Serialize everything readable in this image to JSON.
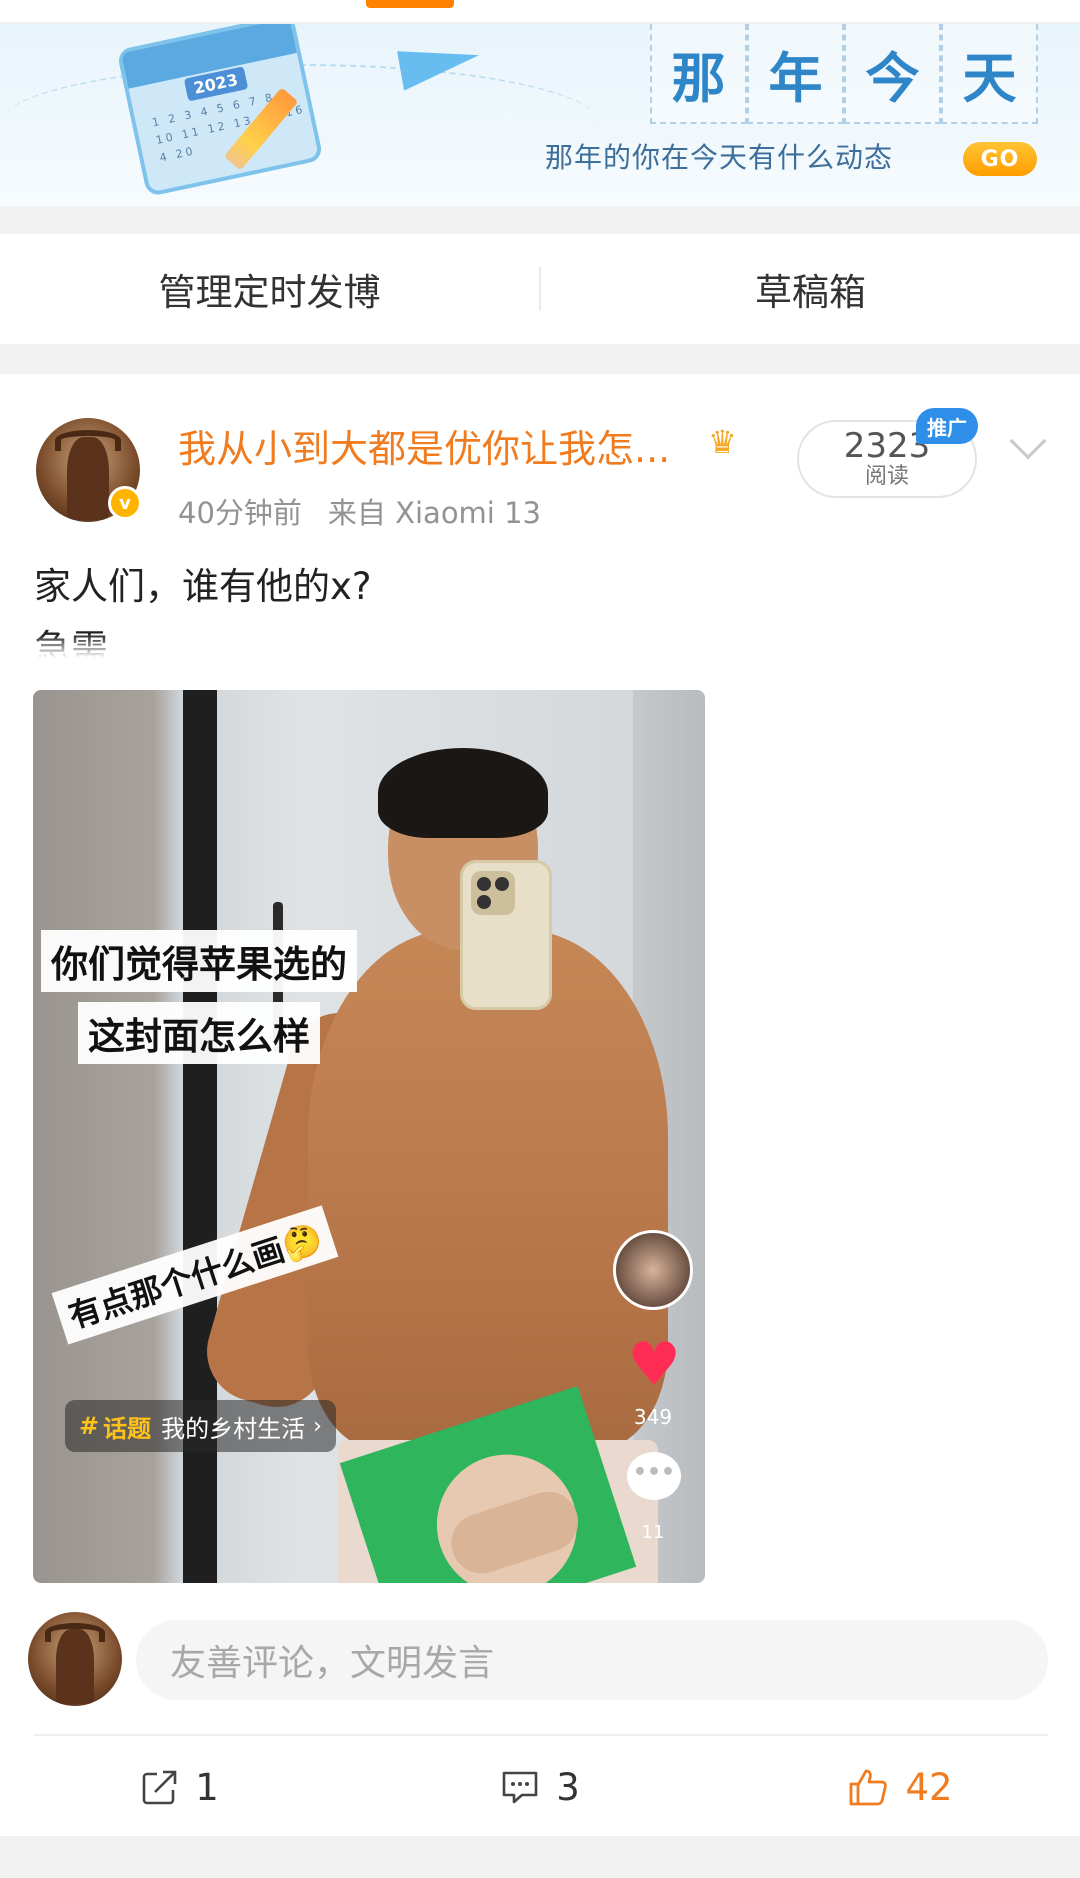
{
  "banner": {
    "year": "2023",
    "calendar_numbers": "1 2 3 4 5 6 7 8 9 10 11 12 13 15 16 4 20",
    "title_chars": [
      "那",
      "年",
      "今",
      "天"
    ],
    "subtitle": "那年的你在今天有什么动态",
    "go_label": "GO"
  },
  "manage_bar": {
    "scheduled": "管理定时发博",
    "drafts": "草稿箱"
  },
  "post": {
    "username": "我从小到大都是优你让我怎...",
    "crown_icon": "crown-icon",
    "verified_mark": "v",
    "time": "40分钟前",
    "source": "来自 Xiaomi 13",
    "reads_count": "2323",
    "reads_label": "阅读",
    "promo_badge": "推广",
    "text_line1": "家人们，谁有他的x?",
    "text_line2": "急需",
    "image": {
      "caption1": "你们觉得苹果选的",
      "caption2": "这封面怎么样",
      "caption3": "有点那个什么画🤔",
      "topic_hash": "#",
      "topic_word": "话题",
      "topic_name": "我的乡村生活",
      "topic_arrow": "›",
      "likes": "349",
      "comments": "11"
    },
    "comment_placeholder": "友善评论，文明发言",
    "actions": {
      "reposts": "1",
      "comments": "3",
      "likes": "42"
    }
  },
  "colors": {
    "accent_orange": "#f07c1f",
    "banner_blue": "#2e86c8",
    "promo_blue": "#2f8fe8",
    "go_yellow": "#ffb400"
  }
}
